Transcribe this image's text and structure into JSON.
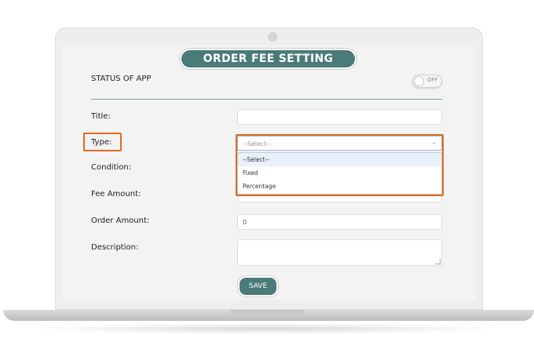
{
  "header": {
    "title": "ORDER FEE SETTING"
  },
  "status": {
    "label": "STATUS OF APP",
    "toggle_text": "OFF"
  },
  "form": {
    "title_label": "Title:",
    "type_label": "Type:",
    "condition_label": "Condition:",
    "fee_amount_label": "Fee Amount:",
    "order_amount_label": "Order Amount:",
    "description_label": "Description:",
    "type_selected": "--Select--",
    "type_options": [
      "--Select--",
      "Fixed",
      "Percentage"
    ],
    "order_amount_value": "0"
  },
  "actions": {
    "save_label": "SAVE"
  },
  "colors": {
    "accent": "#4a7b78",
    "highlight": "#e06a1f"
  }
}
